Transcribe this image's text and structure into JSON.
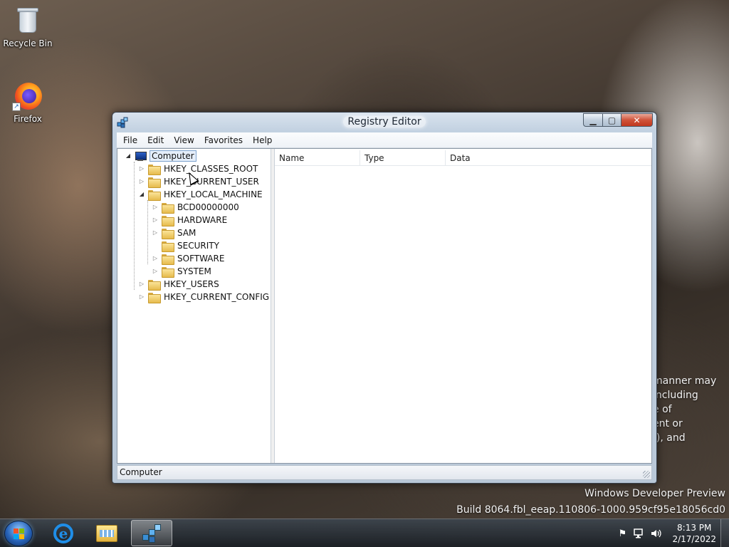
{
  "desktop": {
    "icons": [
      {
        "label": "Recycle Bin",
        "icon": "recycle-bin-icon"
      },
      {
        "label": "Firefox",
        "icon": "firefox-icon"
      }
    ],
    "watermark": {
      "line1": "Windows Developer Preview",
      "line2": "Build 8064.fbl_eeap.110806-1000.959cf95e18056cd0"
    },
    "legal_fragment": [
      "manner may",
      "including",
      "e of",
      "ent or",
      "f), and"
    ]
  },
  "window": {
    "title": "Registry Editor",
    "icon": "regedit-icon",
    "buttons": {
      "minimize": "minimize-icon",
      "maximize": "maximize-icon",
      "close": "close-icon"
    },
    "menu": [
      "File",
      "Edit",
      "View",
      "Favorites",
      "Help"
    ],
    "tree": {
      "root": "Computer",
      "hives": [
        {
          "label": "HKEY_CLASSES_ROOT",
          "expander": "▷"
        },
        {
          "label": "HKEY_CURRENT_USER",
          "expander": "▷"
        },
        {
          "label": "HKEY_LOCAL_MACHINE",
          "expander": "◢",
          "children": [
            {
              "label": "BCD00000000",
              "expander": "▷"
            },
            {
              "label": "HARDWARE",
              "expander": "▷"
            },
            {
              "label": "SAM",
              "expander": "▷"
            },
            {
              "label": "SECURITY",
              "expander": ""
            },
            {
              "label": "SOFTWARE",
              "expander": "▷"
            },
            {
              "label": "SYSTEM",
              "expander": "▷"
            }
          ]
        },
        {
          "label": "HKEY_USERS",
          "expander": "▷"
        },
        {
          "label": "HKEY_CURRENT_CONFIG",
          "expander": "▷"
        }
      ]
    },
    "columns": [
      "Name",
      "Type",
      "Data"
    ],
    "status": "Computer"
  },
  "taskbar": {
    "apps": [
      {
        "name": "internet-explorer",
        "active": false
      },
      {
        "name": "file-explorer",
        "active": false
      },
      {
        "name": "registry-editor",
        "active": true
      }
    ],
    "clock": {
      "time": "8:13 PM",
      "date": "2/17/2022"
    },
    "tray_icons": [
      "action-center-flag-icon",
      "network-icon",
      "volume-icon"
    ]
  },
  "colors": {
    "accent": "#1f8ee8",
    "selection": "#e5eefa",
    "close_button": "#c1381e"
  }
}
